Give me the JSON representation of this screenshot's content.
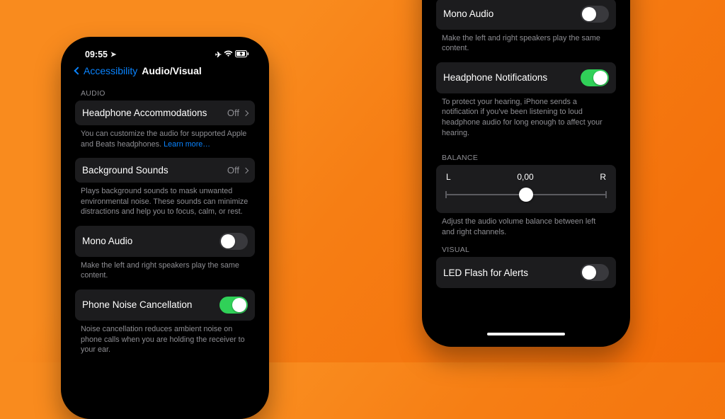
{
  "statusbar": {
    "time": "09:55",
    "icons": {
      "location": "➤",
      "airplane": "✈",
      "wifi": "▾",
      "battery": "▣"
    }
  },
  "nav": {
    "back_label": "Accessibility",
    "title": "Audio/Visual"
  },
  "sections": {
    "audio_header": "AUDIO",
    "balance_header": "BALANCE",
    "visual_header": "VISUAL"
  },
  "rows": {
    "headphone_accommodations": {
      "label": "Headphone Accommodations",
      "value": "Off"
    },
    "background_sounds": {
      "label": "Background Sounds",
      "value": "Off"
    },
    "mono_audio": {
      "label": "Mono Audio",
      "on": false
    },
    "phone_noise_cancellation": {
      "label": "Phone Noise Cancellation",
      "on": true
    },
    "headphone_notifications": {
      "label": "Headphone Notifications",
      "on": true
    },
    "led_flash": {
      "label": "LED Flash for Alerts",
      "on": false
    }
  },
  "descriptions": {
    "headphone_accommodations": "You can customize the audio for supported Apple and Beats headphones.",
    "learn_more": "Learn more…",
    "background_sounds": "Plays background sounds to mask unwanted environmental noise. These sounds can minimize distractions and help you to focus, calm, or rest.",
    "mono_audio": "Make the left and right speakers play the same content.",
    "phone_noise_cancellation": "Noise cancellation reduces ambient noise on phone calls when you are holding the receiver to your ear.",
    "headphone_notifications": "To protect your hearing, iPhone sends a notification if you've been listening to loud headphone audio for long enough to affect your hearing.",
    "balance": "Adjust the audio volume balance between left and right channels."
  },
  "balance": {
    "left_label": "L",
    "value_label": "0,00",
    "right_label": "R"
  }
}
